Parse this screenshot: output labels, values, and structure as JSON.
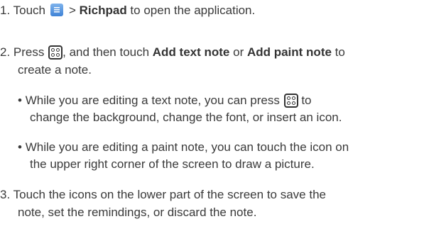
{
  "steps": [
    {
      "number": "1.",
      "part1": "Touch",
      "part2": "> ",
      "bold1": "Richpad",
      "part3": " to open the application.",
      "icon": "app-drawer-icon"
    },
    {
      "number": "2.",
      "part1": "Press",
      "part2": ", and then touch ",
      "bold1": "Add text note",
      "part3": " or ",
      "bold2": "Add paint note",
      "part4": " to",
      "line2": "create a note.",
      "icon": "menu-key-icon"
    },
    {
      "number": "3.",
      "line1": "Touch the icons on the lower part of the screen to save the",
      "line2": "note, set the remindings, or discard the note."
    }
  ],
  "bullets": [
    {
      "marker": "•",
      "line1a": "While you are editing a text note, you can press",
      "line1b": "to",
      "line2": "change the background, change the font, or insert an icon.",
      "icon": "menu-key-icon"
    },
    {
      "marker": "•",
      "line1": "While you are editing a paint note, you can touch the icon on",
      "line2": "the upper right corner of the screen to draw a picture."
    }
  ]
}
